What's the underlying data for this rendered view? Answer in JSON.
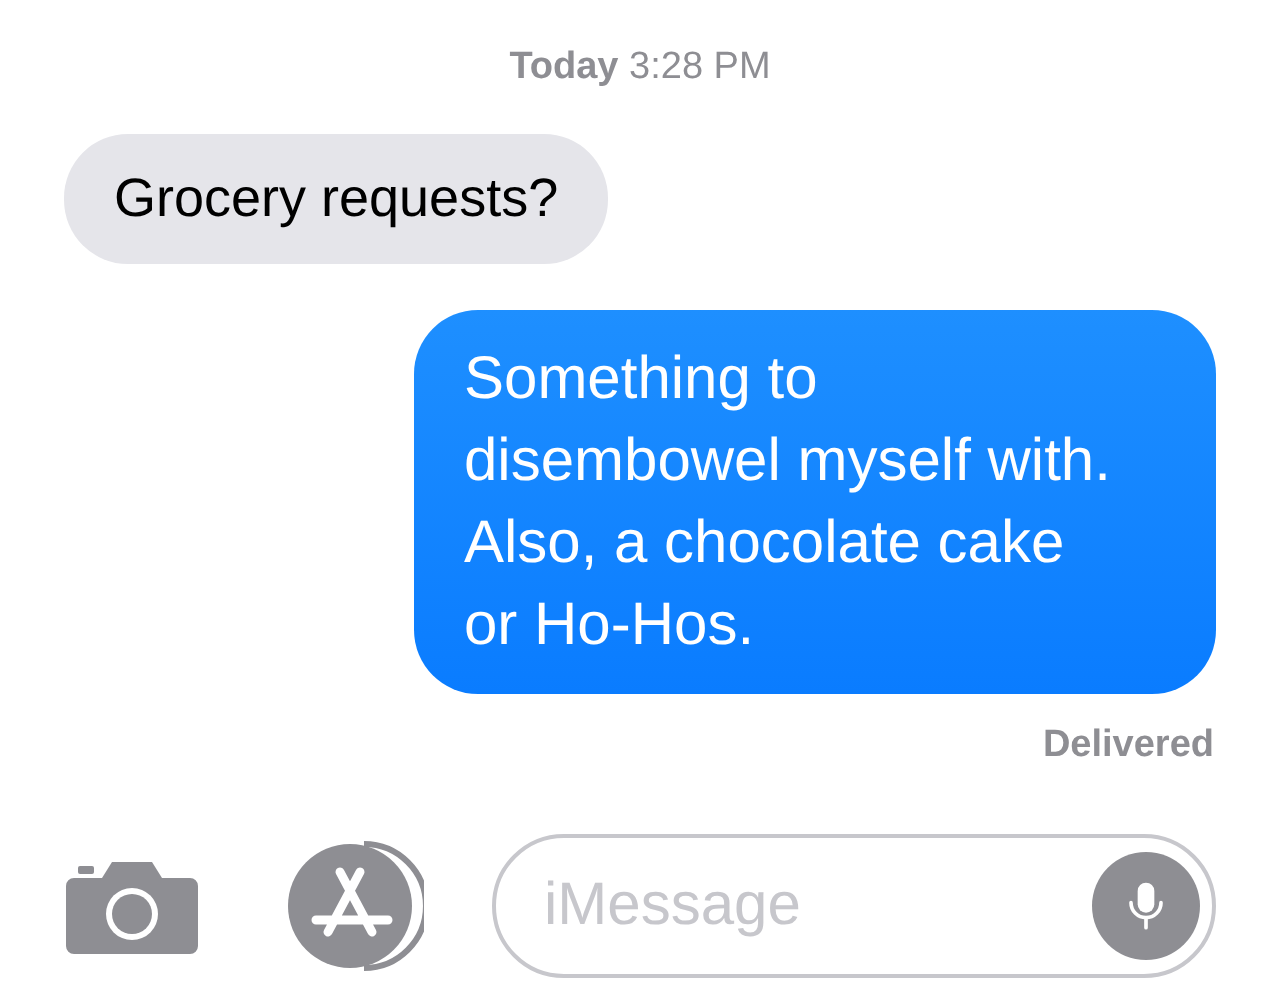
{
  "timestamp": {
    "day": "Today",
    "time": "3:28 PM"
  },
  "messages": [
    {
      "kind": "incoming",
      "text": "Grocery requests?"
    },
    {
      "kind": "outgoing",
      "text": "Something to disembowel myself with. Also, a chocolate cake or Ho-Hos."
    }
  ],
  "status": "Delivered",
  "composer": {
    "placeholder": "iMessage"
  }
}
